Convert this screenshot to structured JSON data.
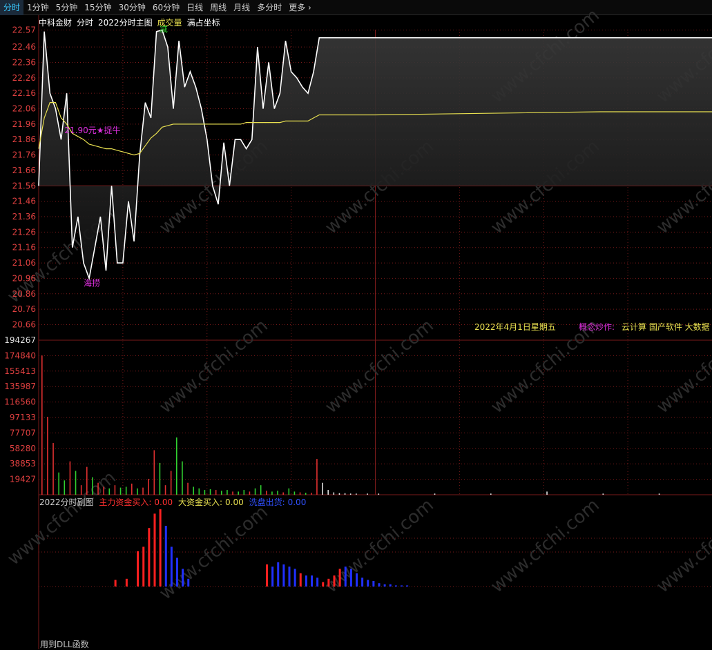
{
  "toolbar": {
    "tabs": [
      {
        "label": "分时",
        "active": true
      },
      {
        "label": "1分钟",
        "active": false
      },
      {
        "label": "5分钟",
        "active": false
      },
      {
        "label": "15分钟",
        "active": false
      },
      {
        "label": "30分钟",
        "active": false
      },
      {
        "label": "60分钟",
        "active": false
      },
      {
        "label": "日线",
        "active": false
      },
      {
        "label": "周线",
        "active": false
      },
      {
        "label": "月线",
        "active": false
      },
      {
        "label": "多分时",
        "active": false
      },
      {
        "label": "更多",
        "active": false
      }
    ],
    "more_icon": "chevron-right-icon"
  },
  "infobar": {
    "stock_name": "中科金财",
    "mode": "分时",
    "indicator": "2022分时主图",
    "volume_label": "成交量",
    "coord_label": "满占坐标"
  },
  "main_overlay": {
    "date_text": "2022年4月1日星期五",
    "concept_label": "概念炒作:",
    "concept_values": "云计算 国产软件 大数据 集"
  },
  "sub_panel": {
    "title": "2022分时副图",
    "main_buy_label": "主力资金买入:",
    "main_buy_value": "0.00",
    "big_buy_label": "大资金买入:",
    "big_buy_value": "0.00",
    "wash_label": "洗盘出货:",
    "wash_value": "0.00"
  },
  "footer": {
    "text": "用到DLL函数"
  },
  "watermark": "www.cfchi.com",
  "colors": {
    "background": "#000000",
    "grid": "#7a1a1a",
    "price_line": "#ffffff",
    "avg_line": "#e8e050",
    "axis_text_price": "#e04040",
    "axis_text_volume": "#e04040",
    "vol_up": "#e03030",
    "vol_down": "#30d030",
    "vol_flat": "#e0e0e0",
    "main_buy": "#ff2020",
    "wash_out": "#2030ff",
    "annotation": "#e030e0",
    "marker_green": "#30d030"
  },
  "chart_data": [
    {
      "type": "line",
      "panel": "price",
      "ylim": [
        20.66,
        22.57
      ],
      "y_ticks": [
        "22.57",
        "22.46",
        "22.36",
        "22.26",
        "22.16",
        "22.06",
        "21.96",
        "21.86",
        "21.76",
        "21.66",
        "21.56",
        "21.46",
        "21.36",
        "21.26",
        "21.16",
        "21.06",
        "20.96",
        "20.86",
        "20.76",
        "20.66"
      ],
      "reference_price": 21.56,
      "series": [
        {
          "x": [
            0,
            2,
            4,
            6,
            8,
            10,
            12,
            14,
            16,
            18,
            20,
            22,
            24,
            26,
            28,
            30,
            32,
            34,
            36,
            38,
            40,
            42,
            44,
            46,
            48,
            50,
            52,
            54,
            56,
            58,
            60,
            62,
            64,
            66,
            68,
            70,
            72,
            74,
            76,
            78,
            80,
            82,
            84,
            86,
            88,
            90,
            92,
            94,
            96,
            98,
            100,
            102,
            104,
            106,
            108,
            110,
            112,
            114,
            116,
            118,
            120,
            240
          ],
          "y": [
            21.56,
            22.56,
            22.16,
            22.06,
            21.86,
            22.16,
            21.16,
            21.36,
            21.06,
            20.96,
            21.16,
            21.36,
            21.01,
            21.56,
            21.06,
            21.06,
            21.46,
            21.2,
            21.76,
            22.1,
            22.0,
            22.56,
            22.57,
            22.46,
            22.06,
            22.5,
            22.2,
            22.3,
            22.2,
            22.06,
            21.86,
            21.56,
            21.44,
            21.84,
            21.56,
            21.86,
            21.86,
            21.8,
            21.86,
            22.46,
            22.06,
            22.36,
            22.06,
            22.16,
            22.5,
            22.3,
            22.26,
            22.2,
            22.16,
            22.3,
            22.52,
            22.52,
            22.52,
            22.52,
            22.52,
            22.52,
            22.52,
            22.52,
            22.52,
            22.52,
            22.52,
            22.52
          ]
        },
        {
          "x": [
            0,
            2,
            4,
            6,
            8,
            10,
            12,
            14,
            16,
            18,
            20,
            22,
            24,
            26,
            28,
            30,
            32,
            34,
            36,
            38,
            40,
            42,
            44,
            46,
            48,
            50,
            52,
            54,
            56,
            58,
            60,
            62,
            64,
            66,
            68,
            70,
            72,
            74,
            76,
            78,
            80,
            82,
            84,
            86,
            88,
            90,
            92,
            94,
            96,
            98,
            100,
            120,
            160,
            200,
            240
          ],
          "y": [
            21.8,
            22.0,
            22.1,
            22.1,
            22.0,
            21.96,
            21.9,
            21.88,
            21.86,
            21.83,
            21.82,
            21.81,
            21.8,
            21.8,
            21.79,
            21.78,
            21.77,
            21.76,
            21.77,
            21.82,
            21.87,
            21.9,
            21.94,
            21.95,
            21.96,
            21.96,
            21.96,
            21.96,
            21.96,
            21.96,
            21.96,
            21.96,
            21.96,
            21.96,
            21.96,
            21.96,
            21.96,
            21.97,
            21.97,
            21.97,
            21.97,
            21.97,
            21.97,
            21.97,
            21.98,
            21.98,
            21.98,
            21.98,
            21.98,
            22.0,
            22.02,
            22.02,
            22.03,
            22.04,
            22.04
          ]
        }
      ],
      "annotations": [
        {
          "x": 6,
          "y": 21.86,
          "text": "21.90元★捉牛"
        },
        {
          "x": 18,
          "y": 20.96,
          "text": "海捞"
        },
        {
          "x": 44,
          "y": 22.57,
          "text": "减"
        }
      ]
    },
    {
      "type": "bar",
      "panel": "volume",
      "ylim": [
        0,
        194267
      ],
      "y_ticks": [
        "194267",
        "174840",
        "155413",
        "135987",
        "116560",
        "97133",
        "77707",
        "58280",
        "38853",
        "19427"
      ],
      "x": [
        0,
        2,
        4,
        6,
        8,
        10,
        12,
        14,
        16,
        18,
        20,
        22,
        24,
        26,
        28,
        30,
        32,
        34,
        36,
        38,
        40,
        42,
        44,
        46,
        48,
        50,
        52,
        54,
        56,
        58,
        60,
        62,
        64,
        66,
        68,
        70,
        72,
        74,
        76,
        78,
        80,
        82,
        84,
        86,
        88,
        90,
        92,
        94,
        96,
        98,
        100,
        102,
        104,
        106,
        108,
        110,
        112,
        116,
        120,
        140,
        160,
        180,
        200,
        220,
        240
      ],
      "values": [
        175000,
        98000,
        65000,
        28000,
        18000,
        42000,
        30000,
        12000,
        35000,
        22000,
        15000,
        10000,
        8000,
        12000,
        9000,
        10000,
        14000,
        8000,
        9000,
        20000,
        56000,
        40000,
        12000,
        30000,
        72000,
        42000,
        15000,
        10000,
        8000,
        6000,
        7000,
        6000,
        5000,
        6000,
        4000,
        4000,
        6000,
        4000,
        8000,
        12000,
        5000,
        4000,
        5000,
        3000,
        8000,
        4000,
        3000,
        2500,
        2500,
        45000,
        15000,
        6000,
        3000,
        2000,
        2000,
        1500,
        1500,
        1500,
        1500,
        1500,
        1500,
        4000,
        1500,
        1500,
        3000
      ],
      "directions": [
        "up",
        "up",
        "up",
        "down",
        "down",
        "up",
        "down",
        "up",
        "up",
        "down",
        "up",
        "up",
        "down",
        "up",
        "down",
        "down",
        "up",
        "down",
        "up",
        "up",
        "up",
        "down",
        "up",
        "up",
        "down",
        "down",
        "up",
        "down",
        "down",
        "down",
        "down",
        "up",
        "down",
        "down",
        "up",
        "down",
        "down",
        "up",
        "down",
        "down",
        "up",
        "down",
        "down",
        "up",
        "down",
        "down",
        "up",
        "down",
        "up",
        "up",
        "flat",
        "flat",
        "flat",
        "flat",
        "flat",
        "flat",
        "flat",
        "flat",
        "flat",
        "flat",
        "flat",
        "flat",
        "flat",
        "flat",
        "flat"
      ]
    },
    {
      "type": "bar",
      "panel": "capital_flow",
      "x": [
        26,
        30,
        34,
        36,
        38,
        40,
        42,
        44,
        46,
        48,
        50,
        52,
        80,
        82,
        84,
        86,
        88,
        90,
        92,
        94,
        96,
        98,
        100,
        102,
        104,
        106,
        108,
        110,
        112,
        114,
        116,
        118,
        120,
        122,
        124,
        126,
        128,
        130
      ],
      "values": [
        6,
        7,
        32,
        36,
        53,
        66,
        70,
        55,
        36,
        26,
        16,
        7,
        20,
        18,
        22,
        20,
        18,
        16,
        12,
        10,
        10,
        8,
        4,
        7,
        10,
        16,
        18,
        16,
        12,
        8,
        6,
        5,
        3,
        2,
        2,
        1,
        1,
        1
      ],
      "categories_series": [
        "main_buy",
        "main_buy",
        "main_buy",
        "main_buy",
        "main_buy",
        "main_buy",
        "main_buy",
        "wash_out",
        "wash_out",
        "wash_out",
        "wash_out",
        "wash_out",
        "main_buy",
        "wash_out",
        "wash_out",
        "wash_out",
        "wash_out",
        "wash_out",
        "main_buy",
        "wash_out",
        "wash_out",
        "wash_out",
        "main_buy",
        "main_buy",
        "main_buy",
        "main_buy",
        "wash_out",
        "wash_out",
        "wash_out",
        "wash_out",
        "wash_out",
        "wash_out",
        "wash_out",
        "wash_out",
        "wash_out",
        "wash_out",
        "wash_out",
        "wash_out"
      ]
    }
  ]
}
